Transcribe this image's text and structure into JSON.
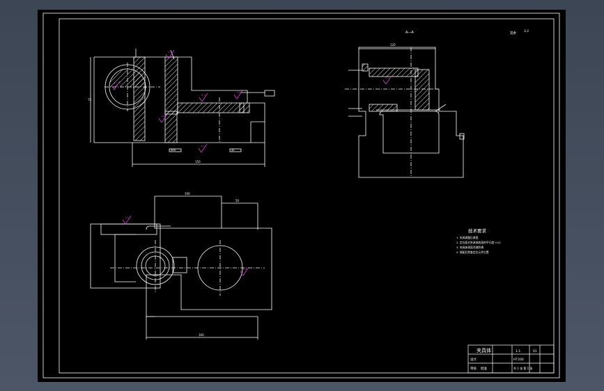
{
  "app": {
    "background_gradient": [
      "#3d4654",
      "#4d5667"
    ],
    "paper_color": "#000000",
    "line_color": "#ffffff",
    "annotation_color": "#c040c0",
    "hatch_color": "#ffffff"
  },
  "drawing": {
    "view_label": "A—A",
    "roughness_other": "其余",
    "roughness_other_value": "3.2",
    "tech_requirements": {
      "title": "技术要求",
      "items": [
        "1. 夹具调整后紧固",
        "2. 定位面对夹具体底面的平行度 0.02",
        "3. 夹具体表面涂漆防锈",
        "4. 装配后检查定位元件位置"
      ]
    },
    "title_block": {
      "part_name": "夹具体",
      "designer_row": "设计",
      "checker_row": "审核",
      "approve_row": "批准",
      "drawing_no": "01",
      "scale": "1:1",
      "sheet": "共 1 张 第 1 张",
      "material": "HT200"
    },
    "dimension_labels": {
      "top_left_total": "150",
      "top_left_height": "75",
      "top_left_sub1": "Φ20",
      "top_left_sub2": "40",
      "top_right_width": "120",
      "bottom_top_dim": "100",
      "bottom_bottom_dim": "160",
      "bottom_right_dim": "50"
    },
    "roughness_marks": [
      "1.6",
      "3.2",
      "6.3",
      "1.6",
      "3.2",
      "12.5",
      "3.2",
      "1.6",
      "6.3"
    ]
  }
}
